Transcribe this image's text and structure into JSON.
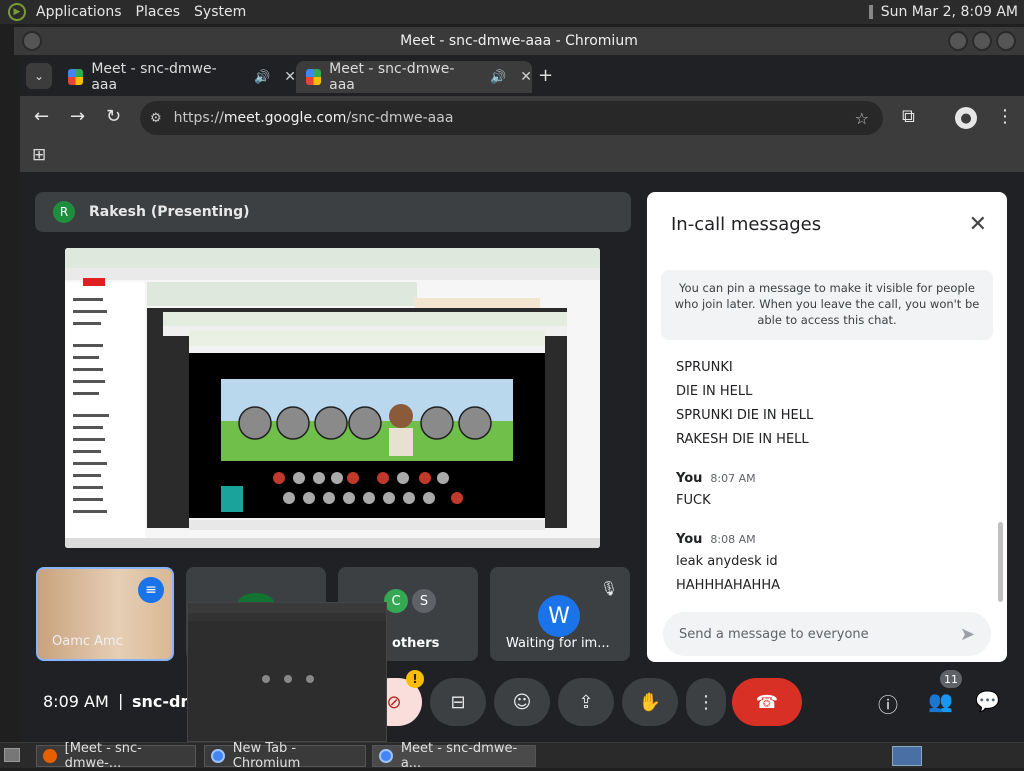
{
  "panel": {
    "applications": "Applications",
    "places": "Places",
    "system": "System",
    "clock": "Sun Mar 2,  8:09 AM"
  },
  "window": {
    "title": "Meet - snc-dmwe-aaa - Chromium"
  },
  "tabs": [
    {
      "label": "Meet - snc-dmwe-aaa"
    },
    {
      "label": "Meet - snc-dmwe-aaa"
    }
  ],
  "omnibox": {
    "scheme": "https://",
    "host": "meet.google.com",
    "path": "/snc-dmwe-aaa"
  },
  "meet": {
    "presenter": {
      "avatar_letter": "R",
      "name": "Rakesh (Presenting)"
    },
    "tiles": [
      {
        "label": "Oamc Amc"
      },
      {
        "label": ""
      },
      {
        "label": "others",
        "avatars": [
          "C",
          "S"
        ]
      },
      {
        "label": "Waiting for im...",
        "avatar": "W"
      }
    ],
    "bottom": {
      "time": "8:09 AM",
      "separator": "|",
      "meeting_code": "snc-dm",
      "people_count": "11"
    }
  },
  "chat": {
    "title": "In-call messages",
    "info": "You can pin a message to make it visible for people who join later. When you leave the call, you won't be able to access this chat.",
    "messages_block1": [
      "SPRUNKI",
      "DIE IN HELL",
      "SPRUNKI DIE IN HELL",
      "RAKESH DIE IN HELL"
    ],
    "group2": {
      "sender": "You",
      "time": "8:07 AM",
      "text": "FUCK"
    },
    "group3": {
      "sender": "You",
      "time": "8:08 AM",
      "texts": [
        "leak anydesk id",
        "HAHHHAHAHHA"
      ]
    },
    "input_placeholder": "Send a message to everyone"
  },
  "taskbar": {
    "items": [
      "[Meet - snc-dmwe-...",
      "New Tab - Chromium",
      "Meet - snc-dmwe-a..."
    ]
  },
  "icons": {
    "sound": "speaker-icon",
    "close": "close-icon"
  }
}
